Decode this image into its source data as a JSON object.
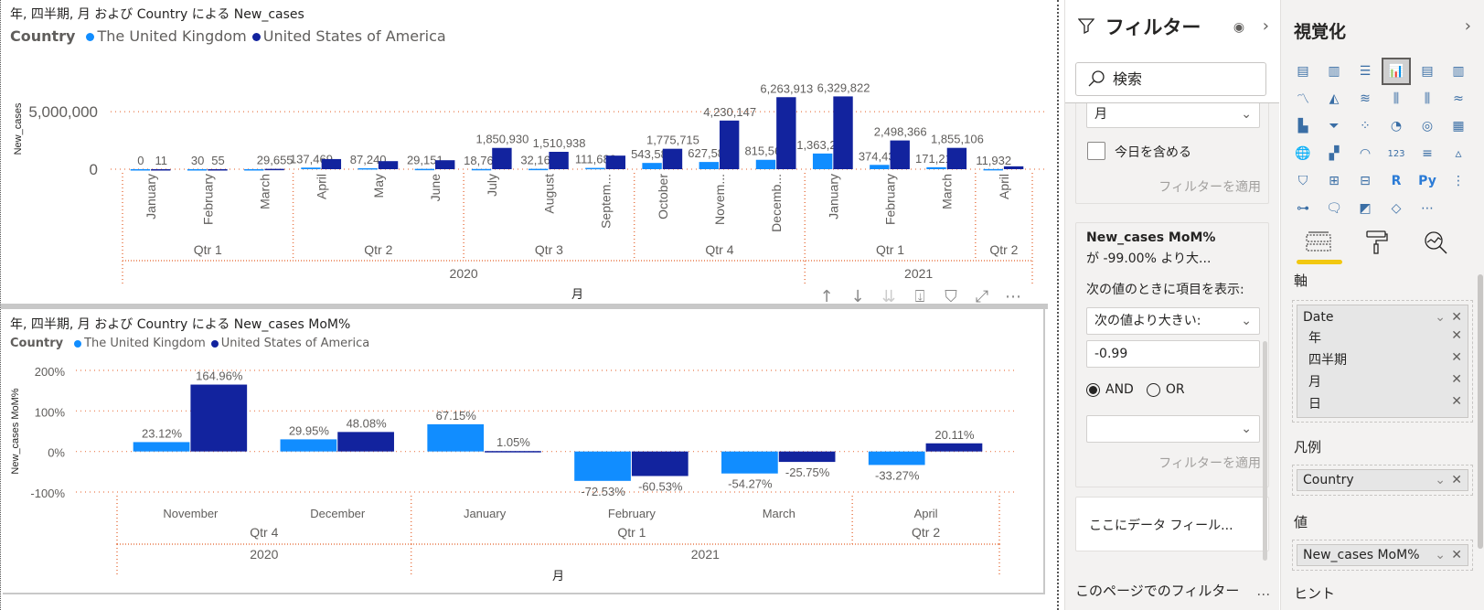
{
  "visual1": {
    "title": "年, 四半期, 月 および Country による New_cases",
    "legend_title": "Country",
    "ylabel": "New_cases",
    "xlabel": "月"
  },
  "visual2": {
    "title": "年, 四半期, 月 および Country による New_cases MoM%",
    "legend_title": "Country",
    "ylabel": "New_cases MoM%",
    "xlabel": "月"
  },
  "colors": {
    "uk": "#118dff",
    "us": "#12239e",
    "grid": "#e97b4d"
  },
  "chart_data": [
    {
      "type": "bar",
      "title": "年, 四半期, 月 および Country による New_cases",
      "xlabel": "月",
      "ylabel": "New_cases",
      "ylim": [
        0,
        7000000
      ],
      "yticks": [
        {
          "v": 0,
          "label": "0"
        },
        {
          "v": 5000000,
          "label": "5,000,000"
        }
      ],
      "legend": "top-left",
      "categories": [
        "January",
        "February",
        "March",
        "April",
        "May",
        "June",
        "July",
        "August",
        "Septem...",
        "October",
        "Novem...",
        "Decemb...",
        "January",
        "February",
        "March",
        "April"
      ],
      "quarters": [
        {
          "label": "Qtr 1",
          "span": 3
        },
        {
          "label": "Qtr 2",
          "span": 3
        },
        {
          "label": "Qtr 3",
          "span": 3
        },
        {
          "label": "Qtr 4",
          "span": 3
        },
        {
          "label": "Qtr 1",
          "span": 3
        },
        {
          "label": "Qtr 2",
          "span": 1
        }
      ],
      "years": [
        {
          "label": "2020",
          "span": 12
        },
        {
          "label": "2021",
          "span": 4
        }
      ],
      "series": [
        {
          "name": "The United Kingdom",
          "values": [
            0,
            30,
            1000,
            137469,
            87240,
            29151,
            18760,
            32166,
            111689,
            543589,
            627582,
            815561,
            1363200,
            374431,
            171217,
            11932
          ],
          "labels": [
            "0",
            "30",
            "",
            "137,469",
            "87,240",
            "29,151",
            "18,760",
            "32,166",
            "111,689",
            "543,589",
            "627,582",
            "815,561",
            "1,363,200",
            "374,431",
            "171,217",
            "11,932"
          ]
        },
        {
          "name": "United States of America",
          "values": [
            11,
            55,
            29655,
            880000,
            700000,
            780000,
            1850930,
            1510938,
            1180000,
            1775715,
            4230147,
            6263913,
            6329822,
            2498366,
            1855106,
            250000
          ],
          "labels": [
            "11",
            "55",
            "29,655",
            "",
            "",
            "",
            "1,850,930",
            "1,510,938",
            "",
            "1,775,715",
            "4,230,147",
            "6,263,913",
            "6,329,822",
            "2,498,366",
            "1,855,106",
            ""
          ]
        }
      ]
    },
    {
      "type": "bar",
      "title": "年, 四半期, 月 および Country による New_cases MoM%",
      "xlabel": "月",
      "ylabel": "New_cases MoM%",
      "ylim": [
        -1.0,
        2.0
      ],
      "yticks": [
        {
          "v": 2.0,
          "label": "200%"
        },
        {
          "v": 1.0,
          "label": "100%"
        },
        {
          "v": 0,
          "label": "0%"
        },
        {
          "v": -1.0,
          "label": "-100%"
        }
      ],
      "legend": "top-left",
      "categories": [
        "November",
        "December",
        "January",
        "February",
        "March",
        "April"
      ],
      "quarters": [
        {
          "label": "Qtr 4",
          "span": 2
        },
        {
          "label": "Qtr 1",
          "span": 3
        },
        {
          "label": "Qtr 2",
          "span": 1
        }
      ],
      "years": [
        {
          "label": "2020",
          "span": 2
        },
        {
          "label": "2021",
          "span": 4
        }
      ],
      "series": [
        {
          "name": "The United Kingdom",
          "values": [
            0.2312,
            0.2995,
            0.6715,
            -0.7253,
            -0.5427,
            -0.3327
          ],
          "labels": [
            "23.12%",
            "29.95%",
            "67.15%",
            "-72.53%",
            "-54.27%",
            "-33.27%"
          ]
        },
        {
          "name": "United States of America",
          "values": [
            1.6496,
            0.4808,
            0.0105,
            -0.6053,
            -0.2575,
            0.2011
          ],
          "labels": [
            "164.96%",
            "48.08%",
            "1.05%",
            "-60.53%",
            "-25.75%",
            "20.11%"
          ]
        }
      ]
    }
  ],
  "filters": {
    "title": "フィルター",
    "search_placeholder": "検索",
    "period_select": "月",
    "include_today": "今日を含める",
    "apply_1": "フィルターを適用",
    "card_title": "New_cases MoM%",
    "card_summary": "が -99.00% より大...",
    "show_when": "次の値のときに項目を表示:",
    "condition_1": "次の値より大きい:",
    "value_1": "-0.99",
    "and_label": "AND",
    "or_label": "OR",
    "condition_2": "",
    "apply_2": "フィルターを適用",
    "drop_here": "ここにデータ フィール...",
    "page_filters": "このページでのフィルター",
    "more": "…"
  },
  "viz": {
    "title": "視覚化",
    "more": "…",
    "axis_label": "軸",
    "axis_field": "Date",
    "axis_sub": [
      "年",
      "四半期",
      "月",
      "日"
    ],
    "legend_label": "凡例",
    "legend_field": "Country",
    "values_label": "値",
    "values_field": "New_cases MoM%",
    "tooltips_label": "ヒント"
  }
}
